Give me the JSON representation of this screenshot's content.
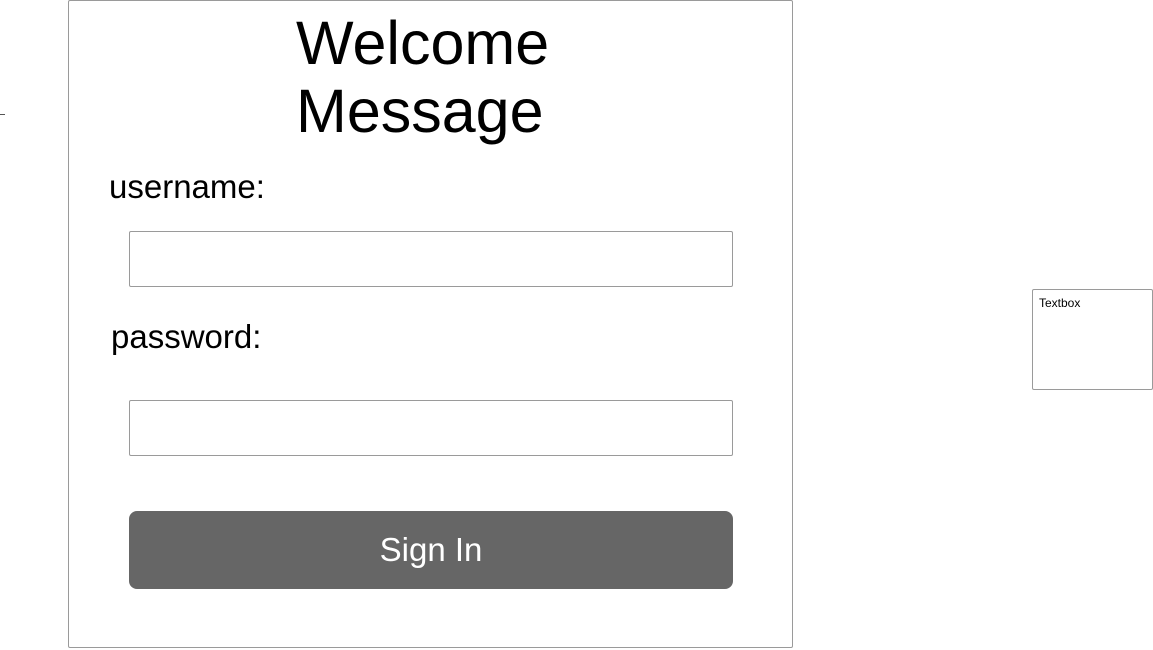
{
  "login": {
    "title": "Welcome Message",
    "username_label": "username:",
    "username_value": "",
    "password_label": "password:",
    "password_value": "",
    "sign_in_label": "Sign In"
  },
  "side_widget": {
    "label": "Textbox"
  },
  "colors": {
    "button_background": "#666666",
    "button_text": "#ffffff",
    "border": "#9a9a9a"
  }
}
